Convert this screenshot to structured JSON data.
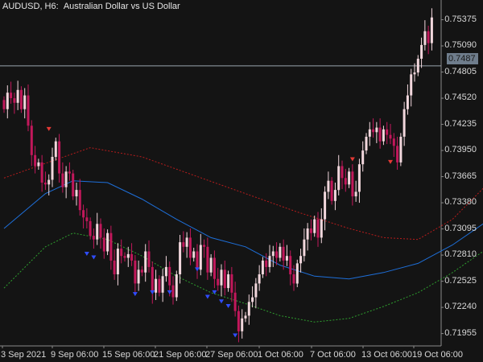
{
  "window": {
    "symbol": "AUDUSD, H6:",
    "description": "Australian Dollar vs US Dollar"
  },
  "price_axis": {
    "labels": [
      "0.75375",
      "0.75090",
      "0.74805",
      "0.74520",
      "0.74235",
      "0.73950",
      "0.73665",
      "0.73380",
      "0.73095",
      "0.72810",
      "0.72525",
      "0.72240",
      "0.71955"
    ],
    "current_price": "0.7487",
    "current_price_value": 0.74872
  },
  "time_axis": {
    "labels": [
      "3 Sep 2021",
      "9 Sep 06:00",
      "15 Sep 06:00",
      "21 Sep 06:00",
      "27 Sep 06:00",
      "1 Oct 06:00",
      "7 Oct 06:00",
      "13 Oct 06:00",
      "19 Oct 06:00"
    ]
  },
  "colors": {
    "background": "#141414",
    "bull_candle": "#f2d7dd",
    "bear_candle": "#c2185b",
    "upper_band": "#b71c1c",
    "middle_line": "#1e6fd9",
    "lower_band": "#2e9e2e",
    "buy_arrow": "#2f4dff",
    "sell_arrow": "#e53935"
  },
  "chart_data": {
    "type": "candlestick",
    "price_range": [
      0.718,
      0.755
    ],
    "closes": [
      0.744,
      0.7458,
      0.7452,
      0.7447,
      0.7461,
      0.744,
      0.7455,
      0.7422,
      0.739,
      0.7378,
      0.7382,
      0.736,
      0.7358,
      0.7363,
      0.7388,
      0.7405,
      0.737,
      0.7355,
      0.7372,
      0.737,
      0.7345,
      0.7352,
      0.733,
      0.7322,
      0.7318,
      0.7302,
      0.7298,
      0.7315,
      0.73,
      0.7285,
      0.7305,
      0.7275,
      0.726,
      0.7288,
      0.728,
      0.7278,
      0.7282,
      0.7275,
      0.725,
      0.7265,
      0.7262,
      0.7285,
      0.7268,
      0.724,
      0.7255,
      0.724,
      0.7258,
      0.7268,
      0.7248,
      0.7235,
      0.726,
      0.7295,
      0.729,
      0.73,
      0.7278,
      0.7285,
      0.7265,
      0.7292,
      0.729,
      0.7262,
      0.7278,
      0.7255,
      0.7248,
      0.7265,
      0.7245,
      0.726,
      0.724,
      0.722,
      0.7198,
      0.7212,
      0.7215,
      0.723,
      0.7235,
      0.725,
      0.726,
      0.7275,
      0.7268,
      0.728,
      0.7285,
      0.7278,
      0.729,
      0.7275,
      0.728,
      0.726,
      0.725,
      0.7272,
      0.728,
      0.7298,
      0.731,
      0.7305,
      0.732,
      0.73,
      0.732,
      0.735,
      0.7362,
      0.734,
      0.7352,
      0.7378,
      0.7365,
      0.7358,
      0.7372,
      0.7345,
      0.735,
      0.738,
      0.7395,
      0.741,
      0.7418,
      0.7415,
      0.742,
      0.7405,
      0.7418,
      0.7412,
      0.7408,
      0.74,
      0.7382,
      0.741,
      0.744,
      0.7455,
      0.7478,
      0.748,
      0.7495,
      0.751,
      0.7525,
      0.7512,
      0.754
    ],
    "upper_band": [
      [
        0,
        0.7365
      ],
      [
        15,
        0.7385
      ],
      [
        25,
        0.7398
      ],
      [
        40,
        0.7388
      ],
      [
        55,
        0.7368
      ],
      [
        70,
        0.7348
      ],
      [
        85,
        0.7328
      ],
      [
        100,
        0.731
      ],
      [
        110,
        0.73
      ],
      [
        120,
        0.7298
      ],
      [
        130,
        0.732
      ],
      [
        140,
        0.7358
      ],
      [
        150,
        0.7395
      ],
      [
        160,
        0.743
      ],
      [
        170,
        0.747
      ]
    ],
    "middle_line": [
      [
        0,
        0.731
      ],
      [
        12,
        0.7348
      ],
      [
        20,
        0.7362
      ],
      [
        30,
        0.736
      ],
      [
        40,
        0.7342
      ],
      [
        50,
        0.732
      ],
      [
        60,
        0.73
      ],
      [
        70,
        0.729
      ],
      [
        80,
        0.727
      ],
      [
        90,
        0.7258
      ],
      [
        100,
        0.7255
      ],
      [
        110,
        0.7262
      ],
      [
        120,
        0.7272
      ],
      [
        130,
        0.7292
      ],
      [
        140,
        0.7318
      ],
      [
        150,
        0.7352
      ],
      [
        160,
        0.7385
      ],
      [
        170,
        0.742
      ]
    ],
    "lower_band": [
      [
        0,
        0.7245
      ],
      [
        12,
        0.729
      ],
      [
        20,
        0.7305
      ],
      [
        30,
        0.7298
      ],
      [
        40,
        0.728
      ],
      [
        50,
        0.7258
      ],
      [
        60,
        0.724
      ],
      [
        70,
        0.7228
      ],
      [
        80,
        0.7215
      ],
      [
        90,
        0.7208
      ],
      [
        100,
        0.7212
      ],
      [
        110,
        0.7225
      ],
      [
        120,
        0.724
      ],
      [
        130,
        0.7262
      ],
      [
        140,
        0.7288
      ],
      [
        150,
        0.7322
      ],
      [
        160,
        0.735
      ],
      [
        170,
        0.738
      ]
    ],
    "buy_arrows": [
      [
        24,
        0.7282
      ],
      [
        26,
        0.7278
      ],
      [
        38,
        0.7238
      ],
      [
        43,
        0.724
      ],
      [
        48,
        0.724
      ],
      [
        56,
        0.7265
      ],
      [
        59,
        0.7235
      ],
      [
        61,
        0.724
      ],
      [
        63,
        0.723
      ],
      [
        65,
        0.7225
      ],
      [
        67,
        0.7193
      ]
    ],
    "sell_arrows": [
      [
        13,
        0.7418
      ],
      [
        101,
        0.7385
      ],
      [
        112,
        0.7382
      ]
    ]
  }
}
